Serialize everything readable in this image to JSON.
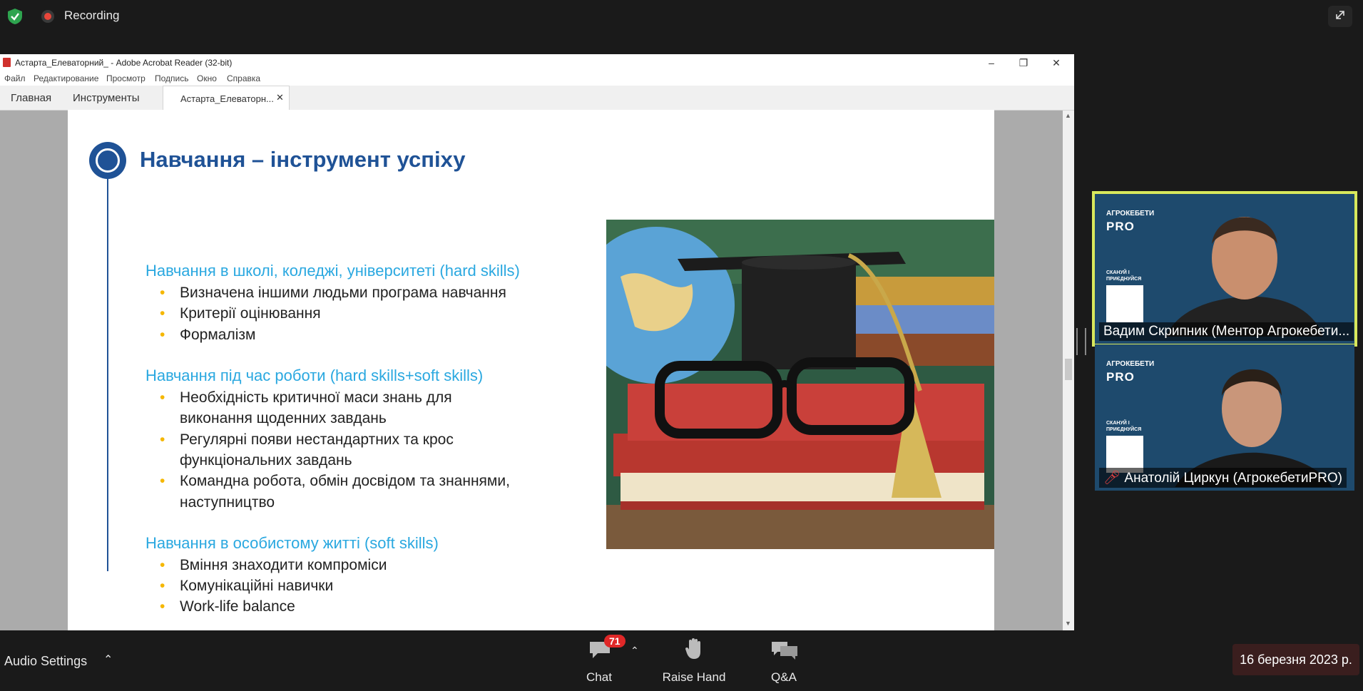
{
  "zoom": {
    "recording_label": "Recording",
    "toolbar": {
      "audio_settings": "Audio Settings",
      "chat_label": "Chat",
      "chat_badge": "71",
      "raise_hand_label": "Raise Hand",
      "qa_label": "Q&A"
    },
    "date_stamp": "16 березня 2023 р."
  },
  "acrobat": {
    "window_title": "Астарта_Елеваторний_ - Adobe Acrobat Reader (32-bit)",
    "menu": [
      "Файл",
      "Редактирование",
      "Просмотр",
      "Подпись",
      "Окно",
      "Справка"
    ],
    "tabs": {
      "home": "Главная",
      "tools": "Инструменты",
      "document": "Астарта_Елеваторн..."
    }
  },
  "slide": {
    "title": "Навчання – інструмент успіху",
    "sections": [
      {
        "heading": "Навчання в школі, коледжі, університеті (hard skills)",
        "bullets": [
          "Визначена іншими людьми програма навчання",
          "Критерії оцінювання",
          "Формалізм"
        ]
      },
      {
        "heading": "Навчання під час роботи (hard skills+soft skills)",
        "bullets": [
          "Необхідність критичної маси знань для",
          "виконання щоденних завдань",
          "Регулярні появи нестандартних та крос",
          "функціональних завдань",
          "Командна робота, обмін досвідом та знаннями,",
          "наступництво"
        ]
      },
      {
        "heading": "Навчання в особистому житті (soft skills)",
        "bullets": [
          "Вміння знаходити компроміси",
          "Комунікаційні навички",
          "Work-life balance"
        ]
      }
    ]
  },
  "participants": [
    {
      "name": "Вадим Скрипник (Ментор Агрокебети...",
      "brand_top": "АГРОКЕБЕТИ",
      "brand_bottom": "PRO",
      "qr_label": "СКАНУЙ І\nПРИЄДНУЙСЯ"
    },
    {
      "name": "Анатолій Циркун (АгрокебетиPRO)",
      "brand_top": "АГРОКЕБЕТИ",
      "brand_bottom": "PRO",
      "qr_label": "СКАНУЙ І\nПРИЄДНУЙСЯ"
    }
  ],
  "colors": {
    "accent_blue": "#1f5296",
    "heading_cyan": "#2aa8e0",
    "bullet_yellow": "#f5b700",
    "active_speaker": "#d8e85c",
    "badge_red": "#e02828"
  }
}
